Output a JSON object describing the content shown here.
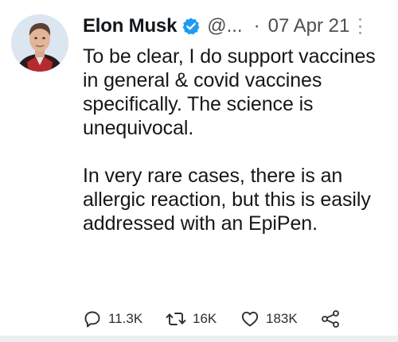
{
  "tweet": {
    "author_name": "Elon Musk",
    "handle": "@...",
    "separator": "·",
    "date": "07 Apr 21",
    "paragraphs": [
      "To be clear, I do support vaccines in general & covid vaccines specifically. The science is unequivocal.",
      "In very rare cases, there is an allergic reaction, but this is easily addressed with an EpiPen."
    ]
  },
  "actions": {
    "reply_count": "11.3K",
    "retweet_count": "16K",
    "like_count": "183K"
  },
  "icons": {
    "verified": "verified-badge-icon",
    "more": "more-options-icon",
    "reply": "reply-icon",
    "retweet": "retweet-icon",
    "like": "heart-icon",
    "share": "share-icon"
  },
  "colors": {
    "verified_blue": "#1d9bf0",
    "text": "#14171a",
    "muted": "#4c4f52"
  }
}
